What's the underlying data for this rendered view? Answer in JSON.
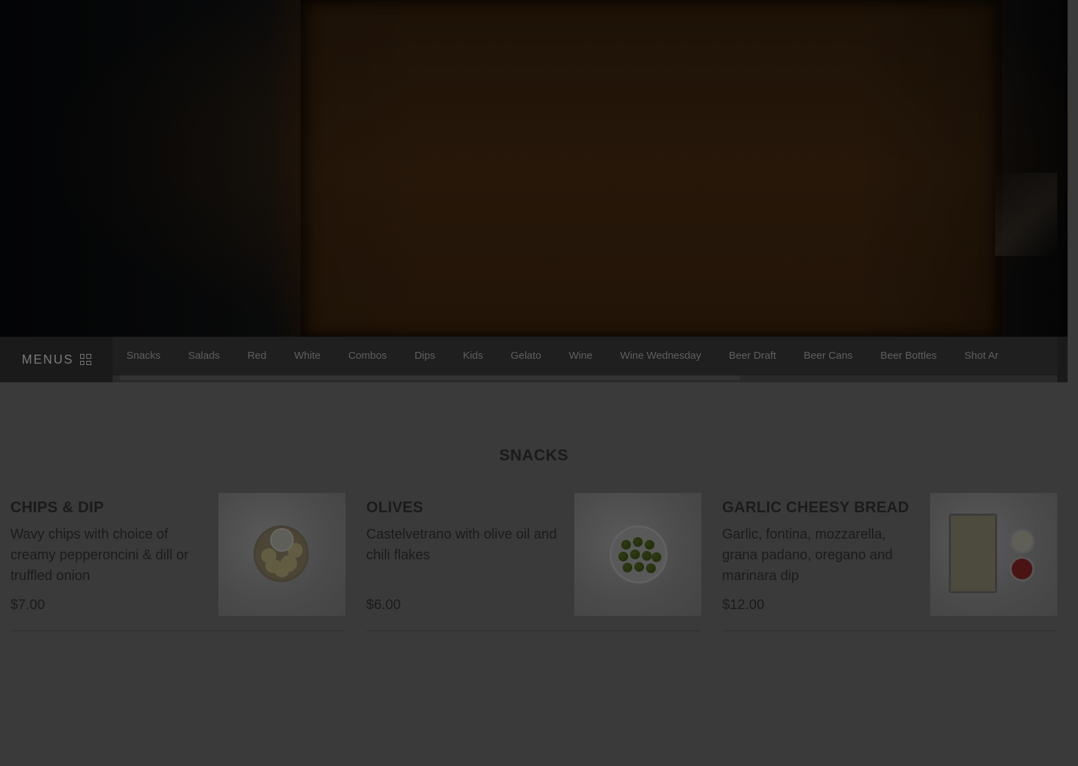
{
  "nav": {
    "menus_label": "MENUS",
    "tabs": [
      "Snacks",
      "Salads",
      "Red",
      "White",
      "Combos",
      "Dips",
      "Kids",
      "Gelato",
      "Wine",
      "Wine Wednesday",
      "Beer Draft",
      "Beer Cans",
      "Beer Bottles",
      "Shot Ar"
    ]
  },
  "section": {
    "title": "SNACKS",
    "items": [
      {
        "name": "CHIPS & DIP",
        "description": "Wavy chips with choice of creamy pepperoncini & dill or truffled onion",
        "price": "$7.00",
        "image_icon": "chips-dip-photo"
      },
      {
        "name": "OLIVES",
        "description": "Castelvetrano with olive oil and chili flakes",
        "price": "$6.00",
        "image_icon": "olives-photo"
      },
      {
        "name": "GARLIC CHEESY BREAD",
        "description": "Garlic, fontina, mozzarella, grana padano, oregano and marinara dip",
        "price": "$12.00",
        "image_icon": "cheesy-bread-photo"
      }
    ]
  },
  "colors": {
    "overlay_background": "#3a3a3a",
    "nav_background": "#1f1f1f",
    "text": "#1b1b1b"
  }
}
